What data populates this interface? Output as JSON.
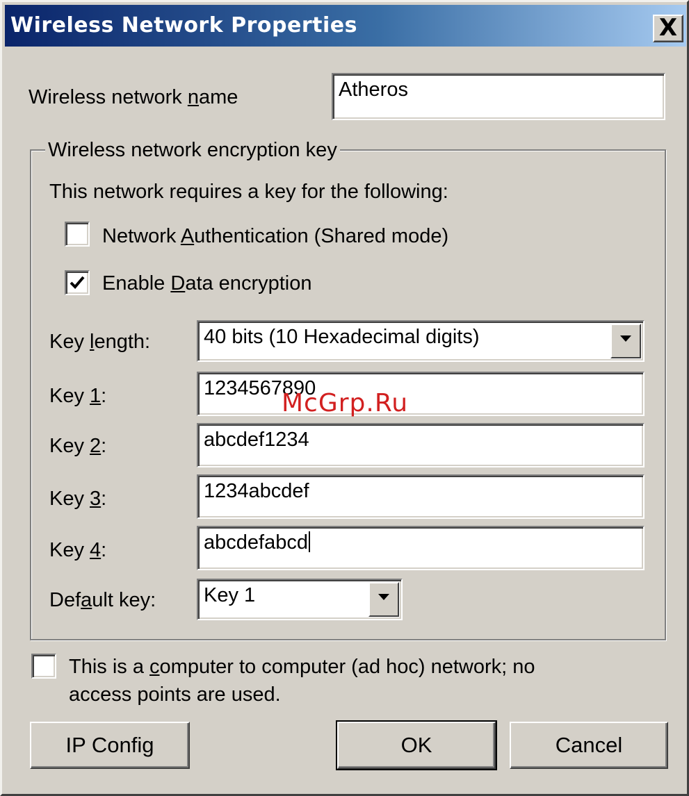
{
  "window": {
    "title": "Wireless Network Properties",
    "close_glyph": "X"
  },
  "network_name": {
    "label_pre": "Wireless network ",
    "label_key": "n",
    "label_post": "ame",
    "value": "Atheros"
  },
  "encryption": {
    "group_title": "Wireless network encryption key",
    "intro": "This network requires a key for the following:",
    "auth_checkbox": {
      "label_pre": "Network  ",
      "label_key": "A",
      "label_post": "uthentication (Shared mode)",
      "checked": false
    },
    "data_checkbox": {
      "label_pre": "Enable ",
      "label_key": "D",
      "label_post": "ata encryption",
      "checked": true
    },
    "key_length": {
      "label_pre": "Key ",
      "label_key": "l",
      "label_post": "ength:",
      "value": "40 bits (10 Hexadecimal digits)"
    },
    "keys": [
      {
        "label_pre": "Key ",
        "label_key": "1",
        "label_post": ":",
        "value": "1234567890"
      },
      {
        "label_pre": "Key ",
        "label_key": "2",
        "label_post": ":",
        "value": "abcdef1234"
      },
      {
        "label_pre": "Key ",
        "label_key": "3",
        "label_post": ":",
        "value": "1234abcdef"
      },
      {
        "label_pre": "Key ",
        "label_key": "4",
        "label_post": ":",
        "value": "abcdefabcd"
      }
    ],
    "default_key": {
      "label_pre": "Def",
      "label_key": "a",
      "label_post": "ult key:",
      "value": "Key 1"
    }
  },
  "adhoc_checkbox": {
    "line1_pre": "This is a ",
    "line1_key": "c",
    "line1_post": "omputer to computer (ad hoc) network; no",
    "line2": "access points are used.",
    "checked": false
  },
  "buttons": {
    "ip_config": "IP Config",
    "ok": "OK",
    "cancel": "Cancel"
  },
  "watermark": "McGrp.Ru",
  "icons": {
    "checkmark": "checkmark-icon",
    "dropdown": "chevron-down-icon"
  }
}
